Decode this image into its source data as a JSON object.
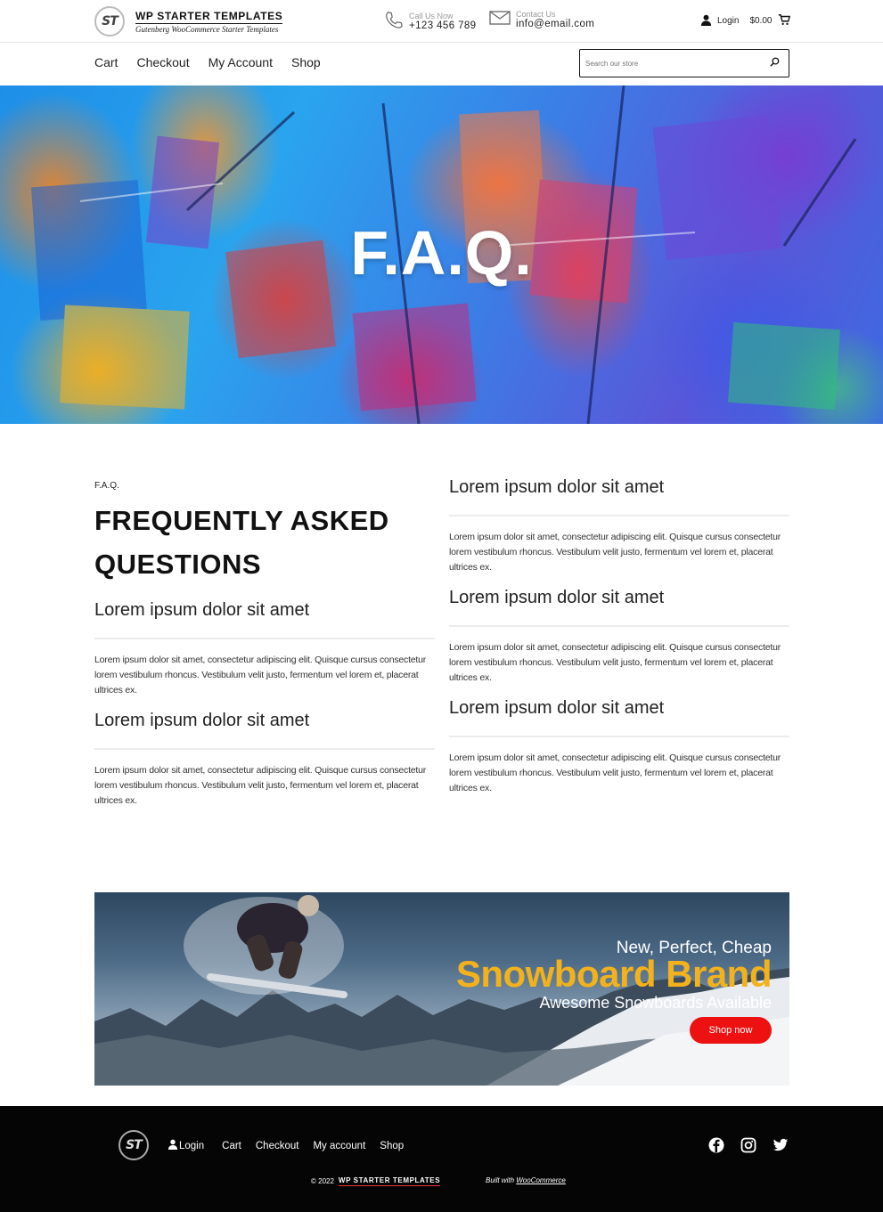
{
  "header": {
    "logo_text": "ST",
    "brand_title": "WP STARTER TEMPLATES",
    "brand_subtitle": "Gutenberg WooCommerce Starter Templates",
    "phone": {
      "label": "Call Us Now",
      "value": "+123 456 789"
    },
    "email": {
      "label": "Contact Us",
      "value": "info@email.com"
    },
    "login_label": "Login",
    "cart_total": "$0.00"
  },
  "nav": {
    "items": [
      "Cart",
      "Checkout",
      "My Account",
      "Shop"
    ],
    "search_placeholder": "Search our store"
  },
  "hero": {
    "title": "F.A.Q."
  },
  "faq": {
    "eyebrow": "F.A.Q.",
    "heading_line1": "FREQUENTLY ASKED",
    "heading_line2": "QUESTIONS",
    "items": [
      {
        "q": "Lorem ipsum dolor sit amet",
        "a": "Lorem ipsum dolor sit amet, consectetur adipiscing elit. Quisque cursus consectetur lorem vestibulum rhoncus. Vestibulum velit justo, fermentum vel lorem et, placerat ultrices ex."
      },
      {
        "q": "Lorem ipsum dolor sit amet",
        "a": "Lorem ipsum dolor sit amet, consectetur adipiscing elit. Quisque cursus consectetur lorem vestibulum rhoncus. Vestibulum velit justo, fermentum vel lorem et, placerat ultrices ex."
      },
      {
        "q": "Lorem ipsum dolor sit amet",
        "a": "Lorem ipsum dolor sit amet, consectetur adipiscing elit. Quisque cursus consectetur lorem vestibulum rhoncus. Vestibulum velit justo, fermentum vel lorem et, placerat ultrices ex."
      },
      {
        "q": "Lorem ipsum dolor sit amet",
        "a": "Lorem ipsum dolor sit amet, consectetur adipiscing elit. Quisque cursus consectetur lorem vestibulum rhoncus. Vestibulum velit justo, fermentum vel lorem et, placerat ultrices ex."
      },
      {
        "q": "Lorem ipsum dolor sit amet",
        "a": "Lorem ipsum dolor sit amet, consectetur adipiscing elit. Quisque cursus consectetur lorem vestibulum rhoncus. Vestibulum velit justo, fermentum vel lorem et, placerat ultrices ex."
      }
    ]
  },
  "promo": {
    "line1": "New, Perfect, Cheap",
    "line2": "Snowboard Brand",
    "line3": "Awesome Snowboards Available",
    "button": "Shop now"
  },
  "footer": {
    "logo_text": "ST",
    "nav": [
      "Login",
      "Cart",
      "Checkout",
      "My account",
      "Shop"
    ],
    "copyright_prefix": "© 2022",
    "copyright_brand": "WP STARTER TEMPLATES",
    "built_with_prefix": "Built with",
    "built_with_link": "WooCommerce",
    "social": [
      "facebook-icon",
      "instagram-icon",
      "twitter-icon"
    ]
  },
  "colors": {
    "accent_yellow": "#f3b21b",
    "button_red": "#ee1111",
    "footer_bg": "#050505"
  }
}
